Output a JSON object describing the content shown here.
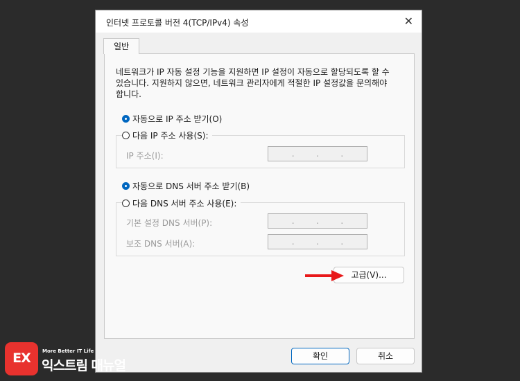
{
  "dialog": {
    "title": "인터넷 프로토콜 버전 4(TCP/IPv4) 속성",
    "close_icon": "close-icon"
  },
  "tabs": [
    {
      "label": "일반",
      "selected": true
    }
  ],
  "description": "네트워크가 IP 자동 설정 기능을 지원하면 IP 설정이 자동으로 할당되도록 할 수 있습니다. 지원하지 않으면, 네트워크 관리자에게 적절한 IP 설정값을 문의해야 합니다.",
  "ip": {
    "auto_label": "자동으로 IP 주소 받기(O)",
    "auto_selected": true,
    "manual_label": "다음 IP 주소 사용(S):",
    "manual_selected": false,
    "address_label": "IP 주소(I):",
    "address_value": ". . ."
  },
  "dns": {
    "auto_label": "자동으로 DNS 서버 주소 받기(B)",
    "auto_selected": true,
    "manual_label": "다음 DNS 서버 주소 사용(E):",
    "manual_selected": false,
    "preferred_label": "기본 설정 DNS 서버(P):",
    "alternate_label": "보조 DNS 서버(A):",
    "preferred_value": ". . .",
    "alternate_value": ". . ."
  },
  "buttons": {
    "advanced": "고급(V)...",
    "ok": "확인",
    "cancel": "취소"
  },
  "colors": {
    "accent": "#0067c0",
    "annotation_arrow": "#e8191a",
    "logo": "#e8322e"
  },
  "watermark": {
    "logo_text": "EX",
    "tagline": "More Better IT Life",
    "name": "익스트림 매뉴얼"
  }
}
